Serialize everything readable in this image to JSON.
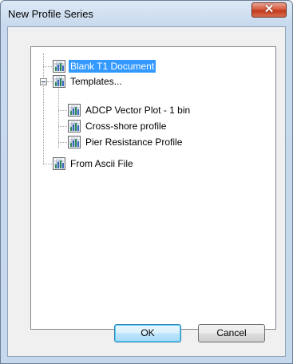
{
  "window": {
    "title": "New Profile Series",
    "close_glyph": "✕"
  },
  "tree": {
    "items": [
      {
        "label": "Blank T1 Document",
        "selected": true,
        "icon": "chart-icon"
      },
      {
        "label": "Templates...",
        "expanded": true,
        "icon": "chart-icon",
        "children": [
          {
            "label": "ADCP Vector Plot - 1 bin",
            "icon": "chart-icon"
          },
          {
            "label": "Cross-shore profile",
            "icon": "chart-icon"
          },
          {
            "label": "Pier Resistance Profile",
            "icon": "chart-icon"
          }
        ]
      },
      {
        "label": "From Ascii File",
        "icon": "chart-icon"
      }
    ]
  },
  "buttons": {
    "ok": "OK",
    "cancel": "Cancel"
  },
  "colors": {
    "selection": "#3399ff",
    "titlebar": "#c9daee",
    "close": "#c23a1d"
  }
}
